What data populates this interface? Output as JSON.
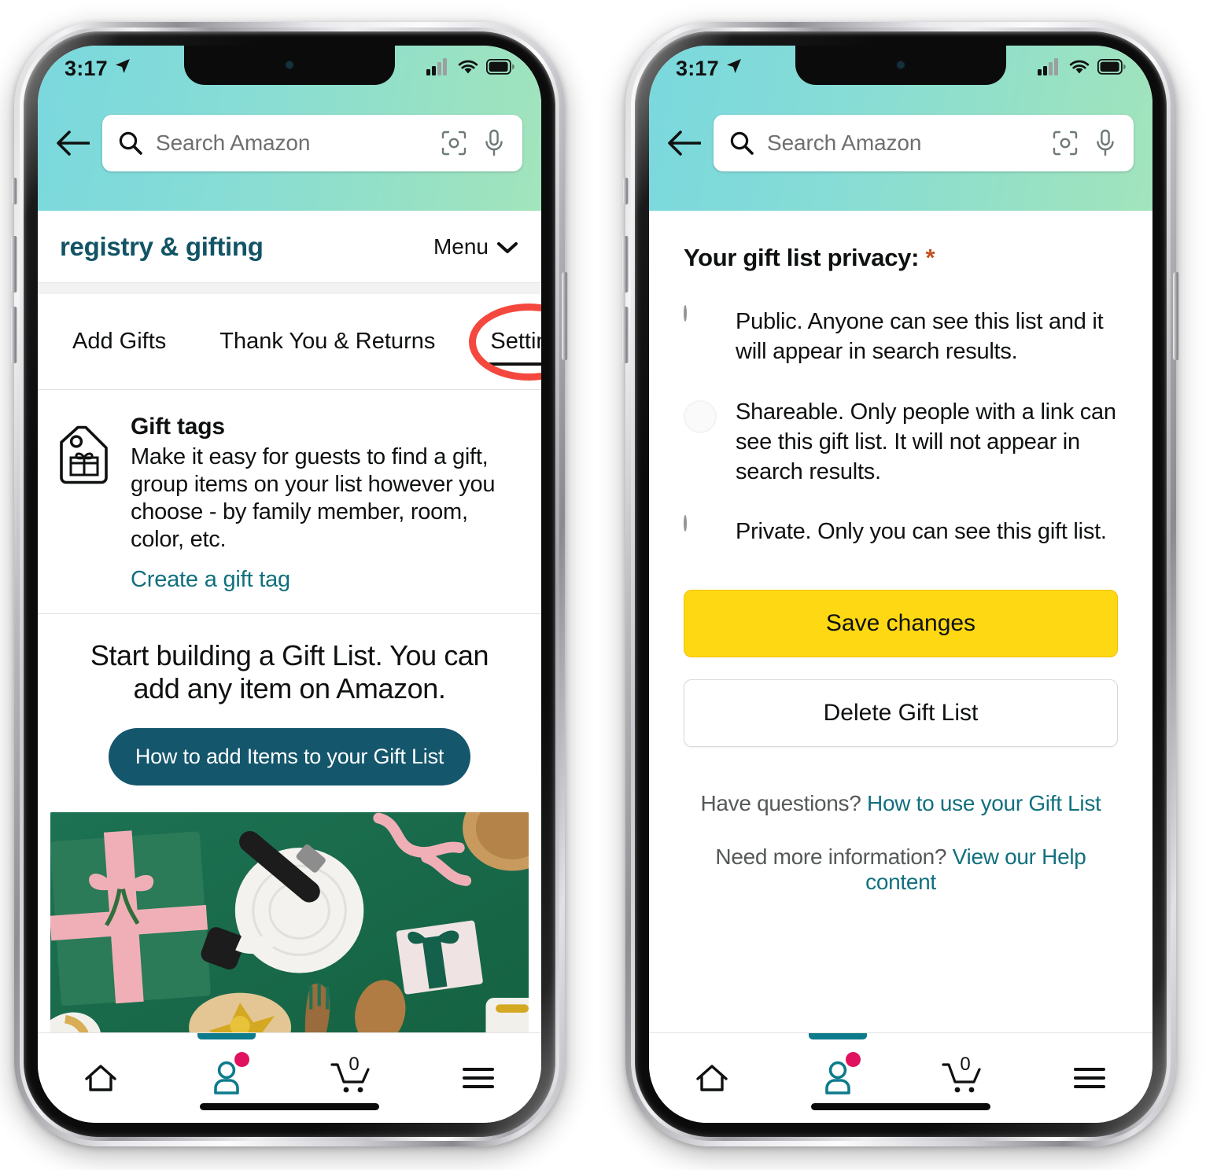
{
  "status_bar": {
    "time": "3:17",
    "location_icon": "location-arrow-icon",
    "cellular_icon": "cellular-bars-icon",
    "wifi_icon": "wifi-icon",
    "battery_icon": "battery-icon"
  },
  "search": {
    "placeholder": "Search Amazon",
    "search_icon": "search-icon",
    "camera_icon": "camera-lens-icon",
    "mic_icon": "microphone-icon",
    "back_icon": "back-arrow-icon"
  },
  "left_phone": {
    "header": {
      "title": "registry & gifting",
      "menu_label": "Menu",
      "menu_chevron": "chevron-down-icon"
    },
    "tabs": [
      {
        "label": "Add Gifts",
        "active": false
      },
      {
        "label": "Thank You & Returns",
        "active": false
      },
      {
        "label": "Settings",
        "active": true
      }
    ],
    "annotation": {
      "shape": "ellipse",
      "color": "#f4483f",
      "target": "Settings"
    },
    "gift_tags": {
      "icon": "gift-tag-icon",
      "title": "Gift tags",
      "description": "Make it easy for guests to find a gift, group items on your list however you choose - by family member, room, color, etc.",
      "link": "Create a gift tag"
    },
    "promo": {
      "heading": "Start building a Gift List. You can add any item on Amazon.",
      "button": "How to add Items to your Gift List",
      "photo_alt": "flat-lay of wrapped gifts, ribbons, wooden spoons and kitchenware on a green background"
    }
  },
  "right_phone": {
    "privacy": {
      "title": "Your gift list privacy:",
      "required_marker": "*",
      "options": [
        {
          "label": "Public. Anyone can see this list and it will appear in search results.",
          "selected": false
        },
        {
          "label": "Shareable. Only people with a link can see this gift list. It will not appear in search results.",
          "selected": true
        },
        {
          "label": "Private. Only you can see this gift list.",
          "selected": false
        }
      ]
    },
    "save_button": "Save changes",
    "delete_button": "Delete Gift List",
    "help": [
      {
        "prefix": "Have questions?",
        "link": "How to use your Gift List"
      },
      {
        "prefix": "Need more information?",
        "link": "View our Help content"
      }
    ]
  },
  "bottom_nav": {
    "items": [
      {
        "icon": "home-icon",
        "active": false,
        "badge": null
      },
      {
        "icon": "person-icon",
        "active": true,
        "badge": "dot"
      },
      {
        "icon": "cart-icon",
        "active": false,
        "badge": "0"
      },
      {
        "icon": "hamburger-menu-icon",
        "active": false,
        "badge": null
      }
    ]
  },
  "colors": {
    "gradient_start": "#7ad8dd",
    "gradient_end": "#a2e4bc",
    "brand_teal": "#11707e",
    "title_blue": "#125465",
    "amazon_yellow": "#ffd814",
    "annotation_red": "#f4483f",
    "badge_pink": "#e0115f",
    "button_navy": "#14566c"
  }
}
